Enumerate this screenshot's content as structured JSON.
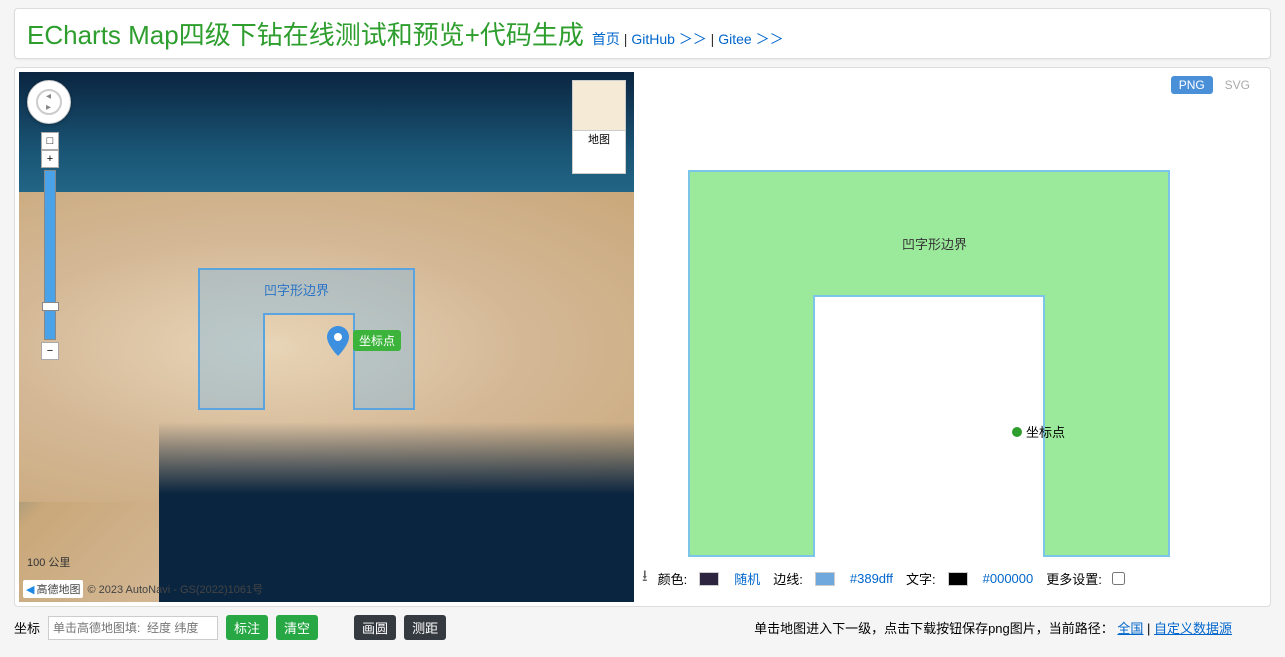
{
  "header": {
    "title": "ECharts Map四级下钻在线测试和预览+代码生成",
    "link_home": "首页",
    "link_github": "GitHub ＞＞",
    "link_gitee": "Gitee ＞＞"
  },
  "map": {
    "type_label": "地图",
    "u_label": "凹字形边界",
    "marker_label": "坐标点",
    "scale": "100 公里",
    "attrib_brand": "高德地图",
    "attrib_text": "© 2023 AutoNavi - GS(2022)1061号",
    "zoom_top": "□",
    "zoom_plus": "+",
    "zoom_minus": "−"
  },
  "chart": {
    "tab_png": "PNG",
    "tab_svg": "SVG",
    "u_label": "凹字形边界",
    "point_label": "坐标点"
  },
  "options": {
    "color_label": "颜色:",
    "color_value": "随机",
    "border_label": "边线:",
    "border_value": "#389dff",
    "text_label": "文字:",
    "text_value": "#000000",
    "more": "更多设置:",
    "swatch_color": "#2d2540",
    "swatch_border": "#6fa8dc",
    "swatch_text": "#000000"
  },
  "footer": {
    "coord_label": "坐标",
    "coord_placeholder": "单击高德地图填:  经度 纬度",
    "btn_mark": "标注",
    "btn_clear": "清空",
    "btn_circle": "画圆",
    "btn_measure": "测距",
    "hint_prefix": "单击地图进入下一级，点击下载按钮保存png图片，当前路径：",
    "hint_link1": "全国",
    "hint_sep": " | ",
    "hint_link2": "自定义数据源"
  },
  "colors": {
    "title": "#2e9e2e",
    "link": "#0066cc",
    "fill": "#9be99b",
    "stroke": "#7bc5e8"
  }
}
